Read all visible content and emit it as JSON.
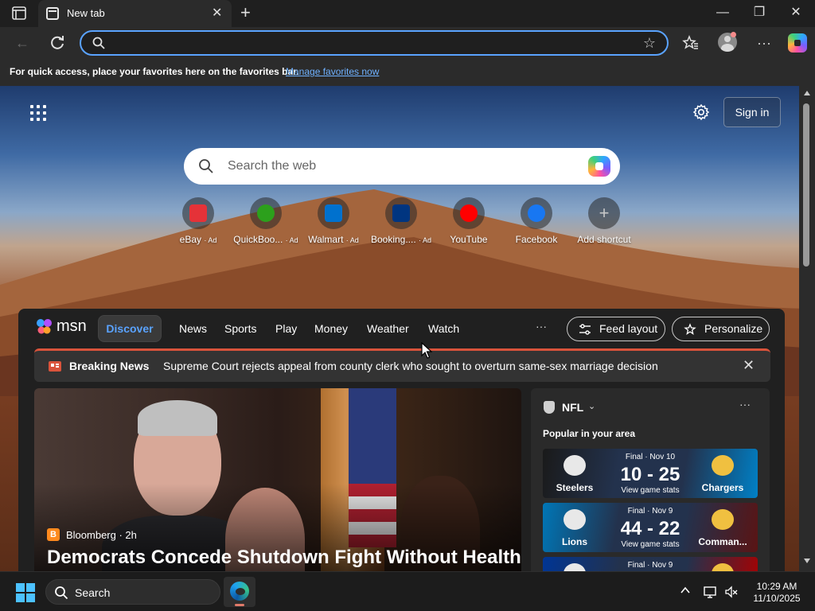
{
  "browser": {
    "tab_title": "New tab",
    "address_value": "",
    "address_placeholder": "",
    "favorites_bar_text": "For quick access, place your favorites here on the favorites bar.",
    "favorites_bar_link": "Manage favorites now"
  },
  "newtab": {
    "sign_in": "Sign in",
    "search_placeholder": "Search the web",
    "shortcuts": [
      {
        "label": "eBay",
        "ad": "· Ad",
        "icon": "ebay-icon",
        "color": "#e53238"
      },
      {
        "label": "QuickBoo...",
        "ad": "· Ad",
        "icon": "quickbooks-icon",
        "color": "#2ca01c"
      },
      {
        "label": "Walmart",
        "ad": "· Ad",
        "icon": "walmart-icon",
        "color": "#0071ce"
      },
      {
        "label": "Booking....",
        "ad": "· Ad",
        "icon": "booking-icon",
        "color": "#003580"
      },
      {
        "label": "YouTube",
        "ad": "",
        "icon": "youtube-icon",
        "color": "#ff0000"
      },
      {
        "label": "Facebook",
        "ad": "",
        "icon": "facebook-icon",
        "color": "#1877f2"
      },
      {
        "label": "Add shortcut",
        "ad": "",
        "icon": "plus-icon",
        "color": "#9a9a9a"
      }
    ]
  },
  "msn": {
    "logo_text": "msn",
    "nav": [
      "Discover",
      "News",
      "Sports",
      "Play",
      "Money",
      "Weather",
      "Watch"
    ],
    "more": "···",
    "feed_layout": "Feed layout",
    "personalize": "Personalize",
    "breaking_label": "Breaking News",
    "breaking_text": "Supreme Court rejects appeal from county clerk who sought to overturn same-sex marriage decision",
    "hero": {
      "source": "Bloomberg · 2h",
      "source_initial": "B",
      "title": "Democrats Concede Shutdown Fight Without Health"
    },
    "nfl": {
      "title": "NFL",
      "subtitle": "Popular in your area",
      "games": [
        {
          "status": "Final · Nov 10",
          "score": "10 - 25",
          "link": "View game stats",
          "home": "Steelers",
          "away": "Chargers",
          "home_color": "#1a1a1a",
          "away_color": "#0080c6"
        },
        {
          "status": "Final · Nov 9",
          "score": "44 - 22",
          "link": "View game stats",
          "home": "Lions",
          "away": "Comman...",
          "home_color": "#0076b6",
          "away_color": "#5a1414"
        },
        {
          "status": "Final · Nov 9",
          "score": "",
          "link": "",
          "home": "",
          "away": "",
          "home_color": "#003594",
          "away_color": "#aa0000"
        }
      ]
    }
  },
  "taskbar": {
    "search_label": "Search",
    "time": "10:29 AM",
    "date": "11/10/2025"
  }
}
